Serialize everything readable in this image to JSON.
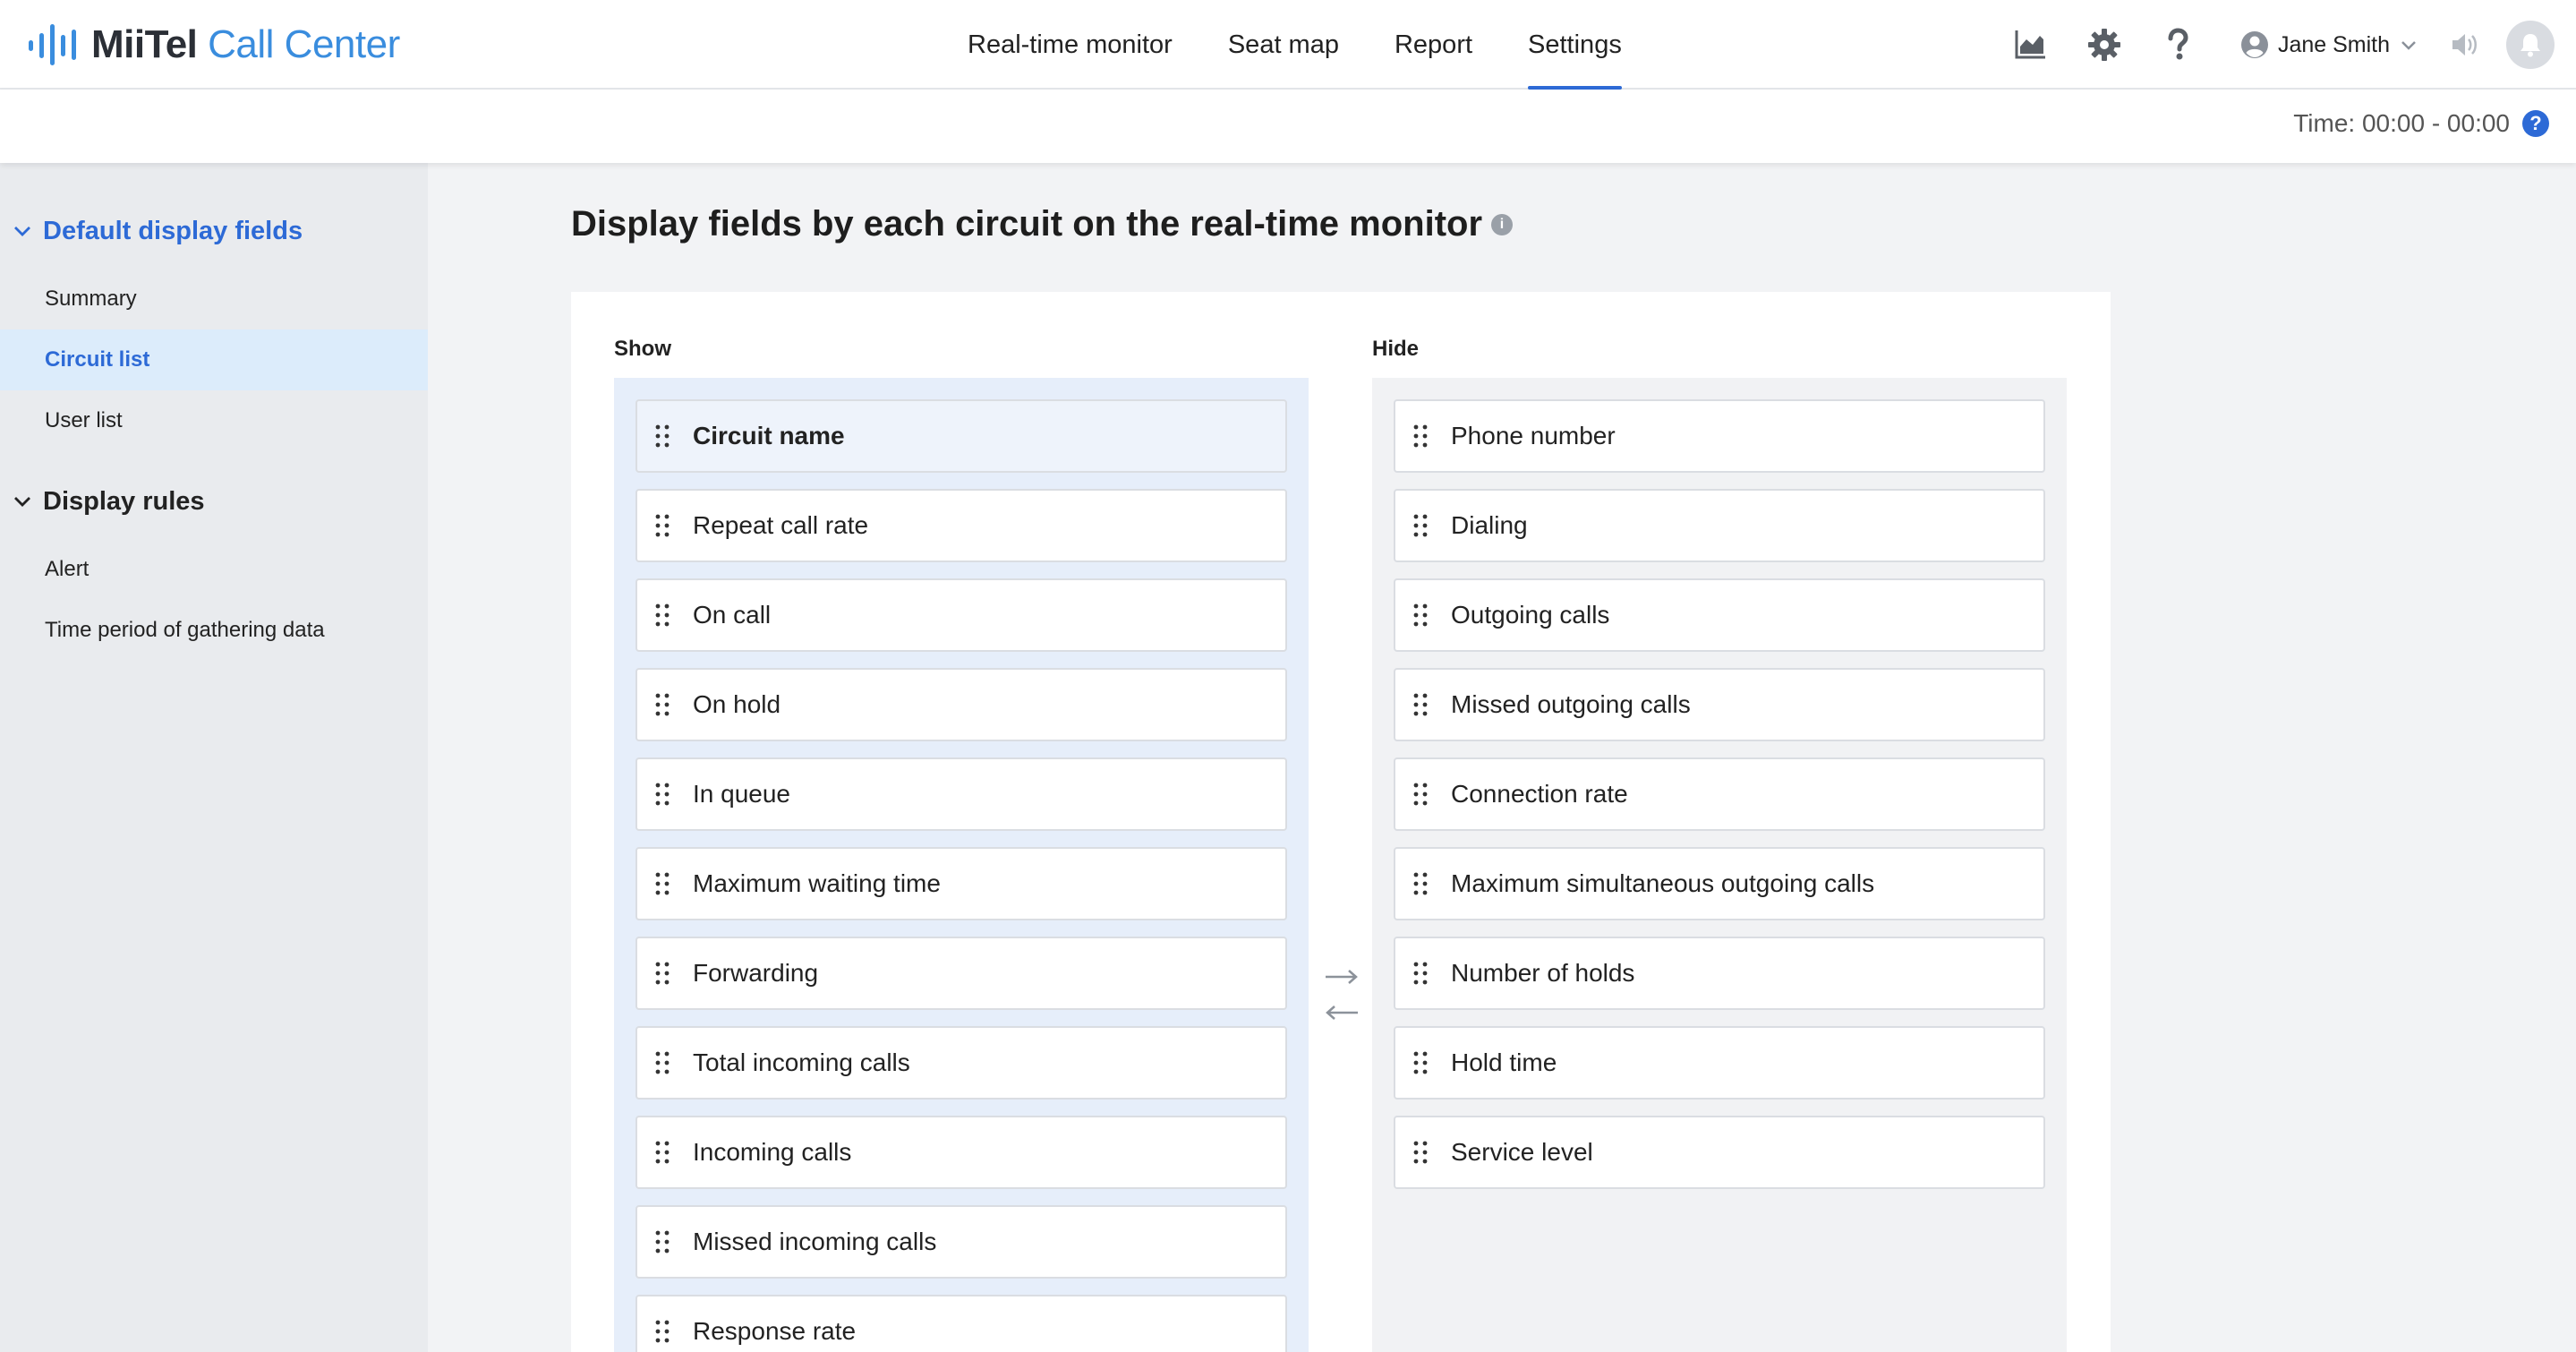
{
  "app": {
    "brand": "MiiTel",
    "product": "Call Center"
  },
  "nav": {
    "items": [
      {
        "label": "Real-time monitor"
      },
      {
        "label": "Seat map"
      },
      {
        "label": "Report"
      },
      {
        "label": "Settings"
      }
    ],
    "active": "Settings"
  },
  "header": {
    "icons": [
      "chart-icon",
      "gear-icon",
      "help-icon"
    ],
    "user_name": "Jane Smith"
  },
  "subheader": {
    "time_text": "Time: 00:00 - 00:00",
    "help_glyph": "?"
  },
  "sidebar": {
    "sections": [
      {
        "label": "Default display fields",
        "items": [
          {
            "label": "Summary"
          },
          {
            "label": "Circuit list"
          },
          {
            "label": "User list"
          }
        ]
      },
      {
        "label": "Display rules",
        "items": [
          {
            "label": "Alert"
          },
          {
            "label": "Time period of gathering data"
          }
        ]
      }
    ],
    "active_item": "Circuit list"
  },
  "main": {
    "title": "Display fields by each circuit on the real-time monitor",
    "info_glyph": "i",
    "show_label": "Show",
    "hide_label": "Hide",
    "show_fields": [
      {
        "label": "Circuit name"
      },
      {
        "label": "Repeat call rate"
      },
      {
        "label": "On call"
      },
      {
        "label": "On hold"
      },
      {
        "label": "In queue"
      },
      {
        "label": "Maximum waiting time"
      },
      {
        "label": "Forwarding"
      },
      {
        "label": "Total incoming calls"
      },
      {
        "label": "Incoming calls"
      },
      {
        "label": "Missed incoming calls"
      },
      {
        "label": "Response rate"
      }
    ],
    "hide_fields": [
      {
        "label": "Phone number"
      },
      {
        "label": "Dialing"
      },
      {
        "label": "Outgoing calls"
      },
      {
        "label": "Missed outgoing calls"
      },
      {
        "label": "Connection rate"
      },
      {
        "label": "Maximum simultaneous outgoing calls"
      },
      {
        "label": "Number of holds"
      },
      {
        "label": "Hold time"
      },
      {
        "label": "Service level"
      }
    ]
  },
  "colors": {
    "accent": "#2d6ad6",
    "logo_blue": "#3a8dde",
    "sidebar_bg": "#e9ebee",
    "active_item_bg": "#dcecfb",
    "show_box_bg": "#e6eefa"
  }
}
